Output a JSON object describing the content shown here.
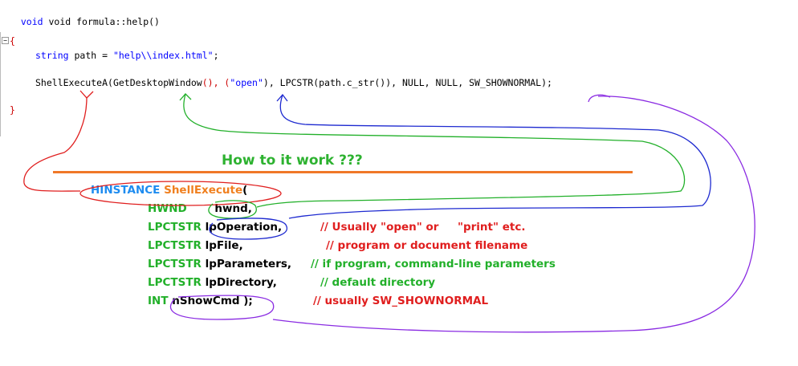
{
  "code": {
    "line1": "void formula::help()",
    "open_brace": "{",
    "line2_type": "string",
    "line2_mid": " path = ",
    "line2_str": "\"help\\\\index.html\"",
    "line2_end": ";",
    "line3_fn": "ShellExecuteA",
    "line3_a": "(GetDesktopWindow",
    "line3_b": "(), (",
    "line3_open": "\"open\"",
    "line3_c": "), LPCSTR(path.c_str()), NULL, NULL, SW_SHOWNORMAL);",
    "close_brace": "}"
  },
  "annotation": {
    "heading": "How to it work ???",
    "hinstance": "HINSTANCE",
    "shellexecute": "ShellExecute",
    "paren": "(",
    "params": [
      {
        "type": "HWND",
        "name": "hwnd,",
        "comment": ""
      },
      {
        "type": "LPCTSTR",
        "name": "lpOperation,",
        "comment": "// Usually \"open\" or     \"print\" etc."
      },
      {
        "type": "LPCTSTR",
        "name": "lpFile,",
        "comment": "// program or document filename"
      },
      {
        "type": "LPCTSTR",
        "name": "lpParameters,",
        "comment": "// if program, command-line parameters"
      },
      {
        "type": "LPCTSTR",
        "name": "lpDirectory,",
        "comment": "// default directory"
      },
      {
        "type": "INT",
        "name": "nShowCmd );",
        "comment": "// usually SW_SHOWNORMAL"
      }
    ]
  },
  "colors": {
    "arrow_red": "#e01e1e",
    "arrow_green": "#22b02a",
    "arrow_blue": "#1e2ad0",
    "arrow_purple": "#8a2be2",
    "rule": "#f07828"
  }
}
